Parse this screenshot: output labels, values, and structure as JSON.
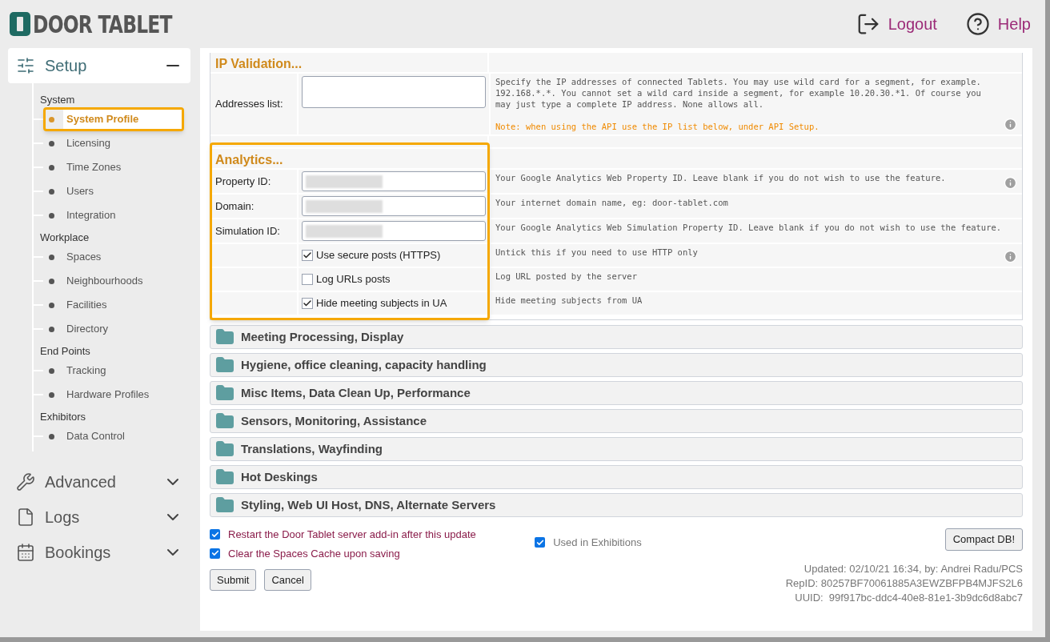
{
  "header": {
    "logo": "DOOR TABLET",
    "actions": [
      {
        "label": "Logout",
        "kind": "logout"
      },
      {
        "label": "Help",
        "kind": "help"
      }
    ]
  },
  "sidebar": [
    {
      "label": "Setup",
      "kind": "setup",
      "expanded": true,
      "groups": [
        {
          "title": "System",
          "items": [
            {
              "label": "System Profile",
              "selected": true,
              "highlighted": true
            },
            {
              "label": "Licensing",
              "selected": false,
              "highlighted": false
            },
            {
              "label": "Time Zones",
              "selected": false,
              "highlighted": false
            },
            {
              "label": "Users",
              "selected": false,
              "highlighted": false
            },
            {
              "label": "Integration",
              "selected": false,
              "highlighted": false
            }
          ]
        },
        {
          "title": "Workplace",
          "items": [
            {
              "label": "Spaces",
              "selected": false,
              "highlighted": false
            },
            {
              "label": "Neighbourhoods",
              "selected": false,
              "highlighted": false
            },
            {
              "label": "Facilities",
              "selected": false,
              "highlighted": false
            },
            {
              "label": "Directory",
              "selected": false,
              "highlighted": false
            }
          ]
        },
        {
          "title": "End Points",
          "items": [
            {
              "label": "Tracking",
              "selected": false,
              "highlighted": false
            },
            {
              "label": "Hardware Profiles",
              "selected": false,
              "highlighted": false
            }
          ]
        },
        {
          "title": "Exhibitors",
          "items": [
            {
              "label": "Data Control",
              "selected": false,
              "highlighted": false
            }
          ]
        }
      ]
    },
    {
      "label": "Advanced",
      "kind": "advanced",
      "expanded": false
    },
    {
      "label": "Logs",
      "kind": "logs",
      "expanded": false
    },
    {
      "label": "Bookings",
      "kind": "bookings",
      "expanded": false
    }
  ],
  "ip_validation": {
    "title": "IP Validation...",
    "rows": [
      {
        "kind": "textarea",
        "label": "Addresses list:",
        "help": "Specify the IP addresses of connected Tablets. You may use wild card for a segment, for example. 192.168.*.*. You cannot set a wild card inside a segment, for example 10.20.30.*1. Of course you may just type a complete IP address. None allows all.",
        "note": "Note: when using the API use the IP list below, under API Setup.",
        "info": true
      }
    ]
  },
  "analytics": {
    "title": "Analytics...",
    "highlighted": true,
    "rows": [
      {
        "kind": "text",
        "label": "Property ID:",
        "redacted": true,
        "help": "Your Google Analytics Web Property ID. Leave blank if you do not wish to use the feature.",
        "info": true
      },
      {
        "kind": "text",
        "label": "Domain:",
        "redacted": true,
        "help": "Your internet domain name, eg: door-tablet.com",
        "info": false
      },
      {
        "kind": "text",
        "label": "Simulation ID:",
        "redacted": true,
        "help": "Your Google Analytics Web Simulation Property ID. Leave blank if you do not wish to use the feature.",
        "info": false
      },
      {
        "kind": "checkbox",
        "label": "Use secure posts (HTTPS)",
        "checked": true,
        "help": "Untick this if you need to use HTTP only",
        "info": true
      },
      {
        "kind": "checkbox",
        "label": "Log URLs posts",
        "checked": false,
        "help": "Log URL posted by the server",
        "info": false
      },
      {
        "kind": "checkbox",
        "label": "Hide meeting subjects in UA",
        "checked": true,
        "help": "Hide meeting subjects from UA",
        "info": false
      }
    ]
  },
  "panels": [
    "Meeting Processing, Display",
    "Hygiene, office cleaning, capacity handling",
    "Misc Items, Data Clean Up, Performance",
    "Sensors, Monitoring, Assistance",
    "Translations, Wayfinding",
    "Hot Deskings",
    "Styling, Web UI Host, DNS, Alternate Servers"
  ],
  "options": [
    {
      "label": "Restart the Door Tablet server add-in after this update",
      "checked": true
    },
    {
      "label": "Clear the Spaces Cache upon saving",
      "checked": true
    }
  ],
  "exhibitions": {
    "label": "Used in Exhibitions",
    "checked": true
  },
  "compact_button": "Compact DB!",
  "buttons": [
    "Submit",
    "Cancel"
  ],
  "footer_lines": [
    "Updated: 02/10/21 16:34, by: Andrei Radu/PCS",
    "RepID: 80257BF70061885A3EWZBFPB4MJFS2L6",
    "UUID:  99f917bc-ddc4-40e8-81e1-3b9dc6d8abc7"
  ]
}
